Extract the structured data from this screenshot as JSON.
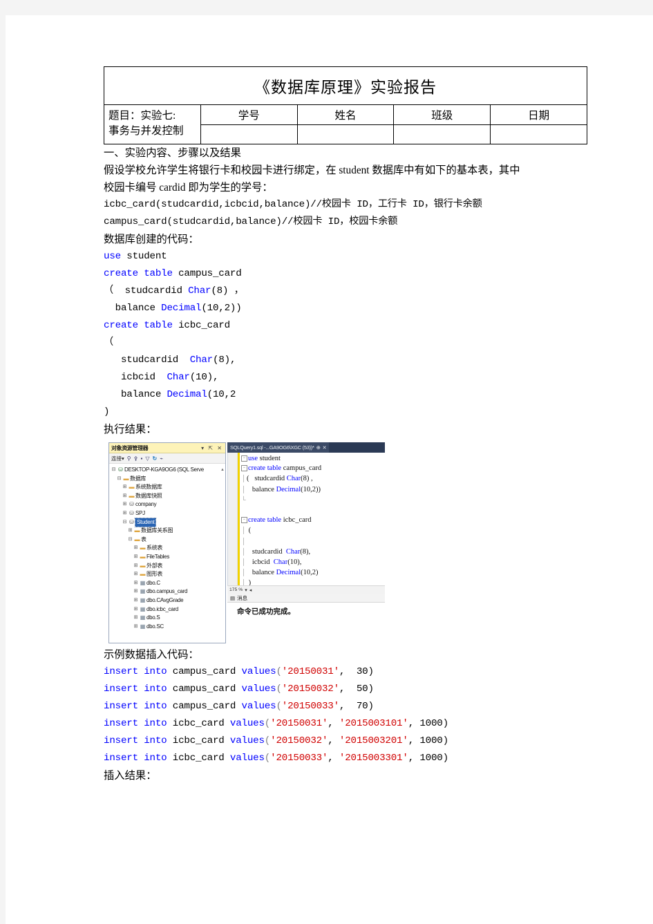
{
  "header_table": {
    "title": "《数据库原理》实验报告",
    "subject_lines": [
      "题目：实验七:",
      "事务与并发控制"
    ],
    "columns": [
      "学号",
      "姓名",
      "班级",
      "日期"
    ],
    "values": [
      "",
      "",
      "",
      ""
    ]
  },
  "document": {
    "section_heading": "一、实验内容、步骤以及结果",
    "intro_lines": [
      "假设学校允许学生将银行卡和校园卡进行绑定，在 student 数据库中有如下的基本表，其中",
      "校园卡编号 cardid 即为学生的学号："
    ],
    "schema_lines": [
      "icbc_card(studcardid,icbcid,balance)//校园卡 ID，工行卡 ID，银行卡余额",
      "campus_card(studcardid,balance)//校园卡 ID，校园卡余额"
    ],
    "create_label": "数据库创建的代码：",
    "exec_label": "执行结果：",
    "insert_label": "示例数据插入代码：",
    "insert_result_label": "插入结果："
  },
  "create_sql": [
    [
      {
        "t": "use",
        "c": "kw"
      },
      {
        "t": " student",
        "c": ""
      }
    ],
    [
      {
        "t": "create",
        "c": "kw"
      },
      {
        "t": " ",
        "c": ""
      },
      {
        "t": "table",
        "c": "kw"
      },
      {
        "t": " campus_card",
        "c": ""
      }
    ],
    [
      {
        "t": "（  studcardid ",
        "c": ""
      },
      {
        "t": "Char",
        "c": "typ"
      },
      {
        "t": "(8) ，",
        "c": ""
      }
    ],
    [
      {
        "t": "  balance ",
        "c": ""
      },
      {
        "t": "Decimal",
        "c": "typ"
      },
      {
        "t": "(10,2))",
        "c": ""
      }
    ],
    [
      {
        "t": "create",
        "c": "kw"
      },
      {
        "t": " ",
        "c": ""
      },
      {
        "t": "table",
        "c": "kw"
      },
      {
        "t": " icbc_card",
        "c": ""
      }
    ],
    [
      {
        "t": "（",
        "c": ""
      }
    ],
    [
      {
        "t": "   studcardid  ",
        "c": ""
      },
      {
        "t": "Char",
        "c": "typ"
      },
      {
        "t": "(8),",
        "c": ""
      }
    ],
    [
      {
        "t": "   icbcid  ",
        "c": ""
      },
      {
        "t": "Char",
        "c": "typ"
      },
      {
        "t": "(10),",
        "c": ""
      }
    ],
    [
      {
        "t": "   balance ",
        "c": ""
      },
      {
        "t": "Decimal",
        "c": "typ"
      },
      {
        "t": "(10,2",
        "c": ""
      }
    ],
    [
      {
        "t": ")",
        "c": ""
      }
    ]
  ],
  "insert_sql": [
    [
      {
        "t": "insert into",
        "c": "kw"
      },
      {
        "t": " campus_card ",
        "c": ""
      },
      {
        "t": "values",
        "c": "kw"
      },
      {
        "t": "(",
        "c": "gray"
      },
      {
        "t": "'20150031'",
        "c": "str"
      },
      {
        "t": ",  30)",
        "c": ""
      }
    ],
    [
      {
        "t": "insert into",
        "c": "kw"
      },
      {
        "t": " campus_card ",
        "c": ""
      },
      {
        "t": "values",
        "c": "kw"
      },
      {
        "t": "(",
        "c": "gray"
      },
      {
        "t": "'20150032'",
        "c": "str"
      },
      {
        "t": ",  50)",
        "c": ""
      }
    ],
    [
      {
        "t": "insert into",
        "c": "kw"
      },
      {
        "t": " campus_card ",
        "c": ""
      },
      {
        "t": "values",
        "c": "kw"
      },
      {
        "t": "(",
        "c": "gray"
      },
      {
        "t": "'20150033'",
        "c": "str"
      },
      {
        "t": ",  70)",
        "c": ""
      }
    ],
    [
      {
        "t": "insert into",
        "c": "kw"
      },
      {
        "t": " icbc_card ",
        "c": ""
      },
      {
        "t": "values",
        "c": "kw"
      },
      {
        "t": "(",
        "c": "gray"
      },
      {
        "t": "'20150031'",
        "c": "str"
      },
      {
        "t": ", ",
        "c": ""
      },
      {
        "t": "'2015003101'",
        "c": "str"
      },
      {
        "t": ", 1000)",
        "c": ""
      }
    ],
    [
      {
        "t": "insert into",
        "c": "kw"
      },
      {
        "t": " icbc_card ",
        "c": ""
      },
      {
        "t": "values",
        "c": "kw"
      },
      {
        "t": "(",
        "c": "gray"
      },
      {
        "t": "'20150032'",
        "c": "str"
      },
      {
        "t": ", ",
        "c": ""
      },
      {
        "t": "'2015003201'",
        "c": "str"
      },
      {
        "t": ", 1000)",
        "c": ""
      }
    ],
    [
      {
        "t": "insert into",
        "c": "kw"
      },
      {
        "t": " icbc_card ",
        "c": ""
      },
      {
        "t": "values",
        "c": "kw"
      },
      {
        "t": "(",
        "c": "gray"
      },
      {
        "t": "'20150033'",
        "c": "str"
      },
      {
        "t": ", ",
        "c": ""
      },
      {
        "t": "'2015003301'",
        "c": "str"
      },
      {
        "t": ", 1000)",
        "c": ""
      }
    ]
  ],
  "screenshot": {
    "object_explorer": {
      "title": "对象资源管理器",
      "title_icons": "▾ ⇱ ✕",
      "toolbar": {
        "connect_label": "连接▾",
        "icons": [
          "connect-icon",
          "disconnect-icon",
          "stop-icon",
          "filter-icon",
          "refresh-icon",
          "activity-icon"
        ]
      },
      "tree": [
        {
          "depth": 0,
          "expander": "⊟",
          "icon": "server",
          "label": "DESKTOP-KGA9OG6 (SQL Serve",
          "selected": false,
          "scroll": "▲"
        },
        {
          "depth": 1,
          "expander": "⊟",
          "icon": "folder",
          "label": "数据库",
          "selected": false
        },
        {
          "depth": 2,
          "expander": "⊞",
          "icon": "folder",
          "label": "系统数据库",
          "selected": false
        },
        {
          "depth": 2,
          "expander": "⊞",
          "icon": "folder",
          "label": "数据库快照",
          "selected": false
        },
        {
          "depth": 2,
          "expander": "⊞",
          "icon": "db",
          "label": "company",
          "selected": false
        },
        {
          "depth": 2,
          "expander": "⊞",
          "icon": "db",
          "label": "SPJ",
          "selected": false
        },
        {
          "depth": 2,
          "expander": "⊟",
          "icon": "db",
          "label": "Student",
          "selected": true
        },
        {
          "depth": 3,
          "expander": "⊞",
          "icon": "folder",
          "label": "数据库关系图",
          "selected": false
        },
        {
          "depth": 3,
          "expander": "⊟",
          "icon": "folder",
          "label": "表",
          "selected": false
        },
        {
          "depth": 4,
          "expander": "⊞",
          "icon": "folder",
          "label": "系统表",
          "selected": false
        },
        {
          "depth": 4,
          "expander": "⊞",
          "icon": "folder",
          "label": "FileTables",
          "selected": false
        },
        {
          "depth": 4,
          "expander": "⊞",
          "icon": "folder",
          "label": "外部表",
          "selected": false
        },
        {
          "depth": 4,
          "expander": "⊞",
          "icon": "folder",
          "label": "图形表",
          "selected": false
        },
        {
          "depth": 4,
          "expander": "⊞",
          "icon": "table",
          "label": "dbo.C",
          "selected": false
        },
        {
          "depth": 4,
          "expander": "⊞",
          "icon": "table",
          "label": "dbo.campus_card",
          "selected": false
        },
        {
          "depth": 4,
          "expander": "⊞",
          "icon": "table",
          "label": "dbo.CAvgGrade",
          "selected": false
        },
        {
          "depth": 4,
          "expander": "⊞",
          "icon": "table",
          "label": "dbo.icbc_card",
          "selected": false
        },
        {
          "depth": 4,
          "expander": "⊞",
          "icon": "table",
          "label": "dbo.S",
          "selected": false
        },
        {
          "depth": 4,
          "expander": "⊞",
          "icon": "table",
          "label": "dbo.SC",
          "selected": false
        }
      ]
    },
    "editor": {
      "tab_label": "SQLQuery1.sql -...GA9OG6\\XGC (53))*",
      "tab_pin": "⊕",
      "tab_close": "✕",
      "zoom_level": "175 %",
      "messages_tab": "消息",
      "message_text": "命令已成功完成。",
      "code": [
        {
          "fold": "box",
          "parts": [
            {
              "t": "use",
              "c": "kw"
            },
            {
              "t": " student",
              "c": ""
            }
          ]
        },
        {
          "fold": "box",
          "parts": [
            {
              "t": "create",
              "c": "kw"
            },
            {
              "t": " ",
              "c": ""
            },
            {
              "t": "table",
              "c": "kw"
            },
            {
              "t": " campus_card",
              "c": ""
            }
          ]
        },
        {
          "fold": "bar",
          "parts": [
            {
              "t": "( ",
              "c": ""
            },
            {
              "t": "  studcardid ",
              "c": ""
            },
            {
              "t": "Char",
              "c": "typ"
            },
            {
              "t": "(8) ,",
              "c": ""
            }
          ]
        },
        {
          "fold": "bar",
          "parts": [
            {
              "t": "   balance ",
              "c": ""
            },
            {
              "t": "Decimal",
              "c": "typ"
            },
            {
              "t": "(10,2))",
              "c": ""
            }
          ]
        },
        {
          "fold": "end",
          "parts": [
            {
              "t": "",
              "c": ""
            }
          ]
        },
        {
          "fold": "none",
          "parts": [
            {
              "t": "",
              "c": ""
            }
          ]
        },
        {
          "fold": "box",
          "parts": [
            {
              "t": "create",
              "c": "kw"
            },
            {
              "t": " ",
              "c": ""
            },
            {
              "t": "table",
              "c": "kw"
            },
            {
              "t": " icbc_card",
              "c": ""
            }
          ]
        },
        {
          "fold": "bar",
          "parts": [
            {
              "t": " (",
              "c": ""
            }
          ]
        },
        {
          "fold": "bar",
          "parts": [
            {
              "t": "",
              "c": ""
            }
          ]
        },
        {
          "fold": "bar",
          "parts": [
            {
              "t": "   studcardid  ",
              "c": ""
            },
            {
              "t": "Char",
              "c": "typ"
            },
            {
              "t": "(8),",
              "c": ""
            }
          ]
        },
        {
          "fold": "bar",
          "parts": [
            {
              "t": "   icbcid  ",
              "c": ""
            },
            {
              "t": "Char",
              "c": "typ"
            },
            {
              "t": "(10),",
              "c": ""
            }
          ]
        },
        {
          "fold": "bar",
          "parts": [
            {
              "t": "   balance ",
              "c": ""
            },
            {
              "t": "Decimal",
              "c": "typ"
            },
            {
              "t": "(10,2)",
              "c": ""
            }
          ]
        },
        {
          "fold": "bar",
          "parts": [
            {
              "t": " )",
              "c": ""
            }
          ]
        }
      ]
    }
  },
  "colors": {
    "keyword": "#0000ff",
    "string": "#d00000",
    "selection": "#2864b4",
    "oe_title_bg": "#fdf3b8",
    "tab_bar_bg": "#2b3a55"
  }
}
